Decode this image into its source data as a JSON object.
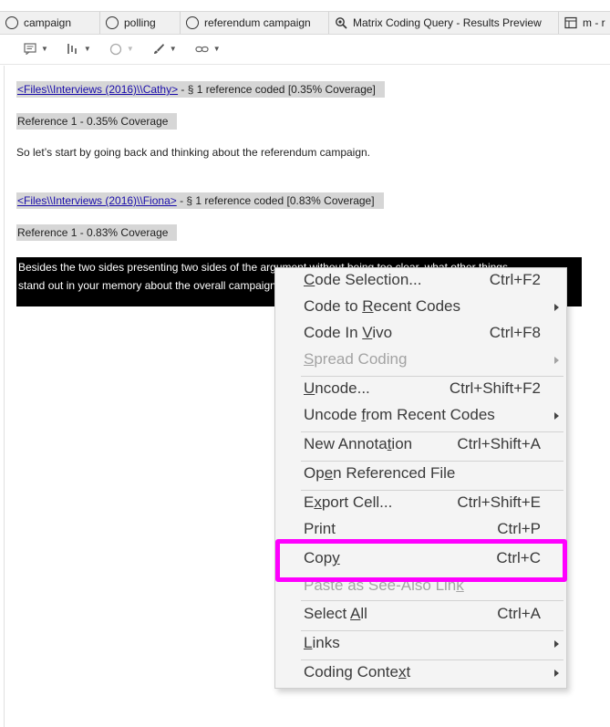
{
  "tabs": [
    {
      "label": "campaign",
      "icon": "node-ring-icon"
    },
    {
      "label": "polling",
      "icon": "node-ring-icon"
    },
    {
      "label": "referendum campaign",
      "icon": "node-ring-icon"
    },
    {
      "label": "Matrix Coding Query - Results Preview",
      "icon": "query-magnifier-icon"
    },
    {
      "label": "m - r",
      "icon": "matrix-table-icon"
    }
  ],
  "toolbar": [
    {
      "icon": "annotation-icon"
    },
    {
      "icon": "coding-stripes-icon"
    },
    {
      "icon": "highlight-circle-icon"
    },
    {
      "icon": "brush-icon"
    },
    {
      "icon": "link-icon"
    }
  ],
  "content": {
    "ref1": {
      "link": "<Files\\\\Interviews (2016)\\\\Cathy>",
      "suffix": " - § 1 reference coded  [0.35% Coverage]",
      "coverage": "Reference 1 - 0.35% Coverage",
      "text": "So let’s start by going back and thinking about the referendum campaign."
    },
    "ref2": {
      "link": "<Files\\\\Interviews (2016)\\\\Fiona>",
      "suffix": " - § 1 reference coded  [0.83% Coverage]",
      "coverage": "Reference 1 - 0.83% Coverage",
      "line1": "Besides the two sides presenting two sides of the argument without being too clear, what other things",
      "line2": "stand out in your memory about the overall campaign?"
    }
  },
  "menu": {
    "code_selection": {
      "pre": "",
      "u": "C",
      "post": "ode Selection...",
      "shortcut": "Ctrl+F2"
    },
    "code_recent": {
      "pre": "Code to ",
      "u": "R",
      "post": "ecent Codes"
    },
    "code_invivo": {
      "pre": "Code In ",
      "u": "V",
      "post": "ivo",
      "shortcut": "Ctrl+F8"
    },
    "spread_coding": {
      "pre": "",
      "u": "S",
      "post": "pread Coding"
    },
    "uncode": {
      "pre": "",
      "u": "U",
      "post": "ncode...",
      "shortcut": "Ctrl+Shift+F2"
    },
    "uncode_recent": {
      "pre": "Uncode ",
      "u": "f",
      "post": "rom Recent Codes"
    },
    "new_annotation": {
      "pre": "New Annota",
      "u": "t",
      "post": "ion",
      "shortcut": "Ctrl+Shift+A"
    },
    "open_ref": {
      "pre": "Op",
      "u": "e",
      "post": "n Referenced File"
    },
    "export_cell": {
      "pre": "E",
      "u": "x",
      "post": "port Cell...",
      "shortcut": "Ctrl+Shift+E"
    },
    "print": {
      "label": "Print",
      "shortcut": "Ctrl+P"
    },
    "copy": {
      "pre": "Cop",
      "u": "y",
      "post": "",
      "shortcut": "Ctrl+C"
    },
    "paste_link": {
      "pre": "Paste as See-Also Lin",
      "u": "k",
      "post": ""
    },
    "select_all": {
      "pre": "Select ",
      "u": "A",
      "post": "ll",
      "shortcut": "Ctrl+A"
    },
    "links": {
      "pre": "",
      "u": "L",
      "post": "inks"
    },
    "coding_context": {
      "pre": "Coding Conte",
      "u": "x",
      "post": "t"
    }
  },
  "colors": {
    "highlight_box": "#ff00ff",
    "link": "#1a0dab",
    "selection": "#000000"
  }
}
